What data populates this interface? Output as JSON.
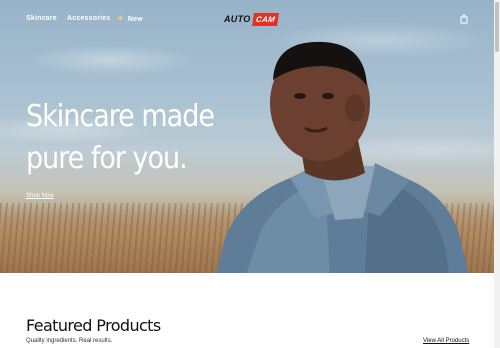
{
  "header": {
    "nav": [
      {
        "label": "Skincare"
      },
      {
        "label": "Accessories"
      },
      {
        "label": "New",
        "icon": "sparkle-icon"
      }
    ],
    "logo": {
      "part1": "AUTO",
      "part2": "CAM",
      "accent_color": "#e23127"
    },
    "cart_icon": "shopping-bag-icon"
  },
  "hero": {
    "headline_line1": "Skincare made",
    "headline_line2": "pure for you.",
    "cta_label": "Shop Now"
  },
  "featured": {
    "title": "Featured Products",
    "subtitle": "Quality ingredients. Real results.",
    "view_all_label": "View All Products"
  }
}
